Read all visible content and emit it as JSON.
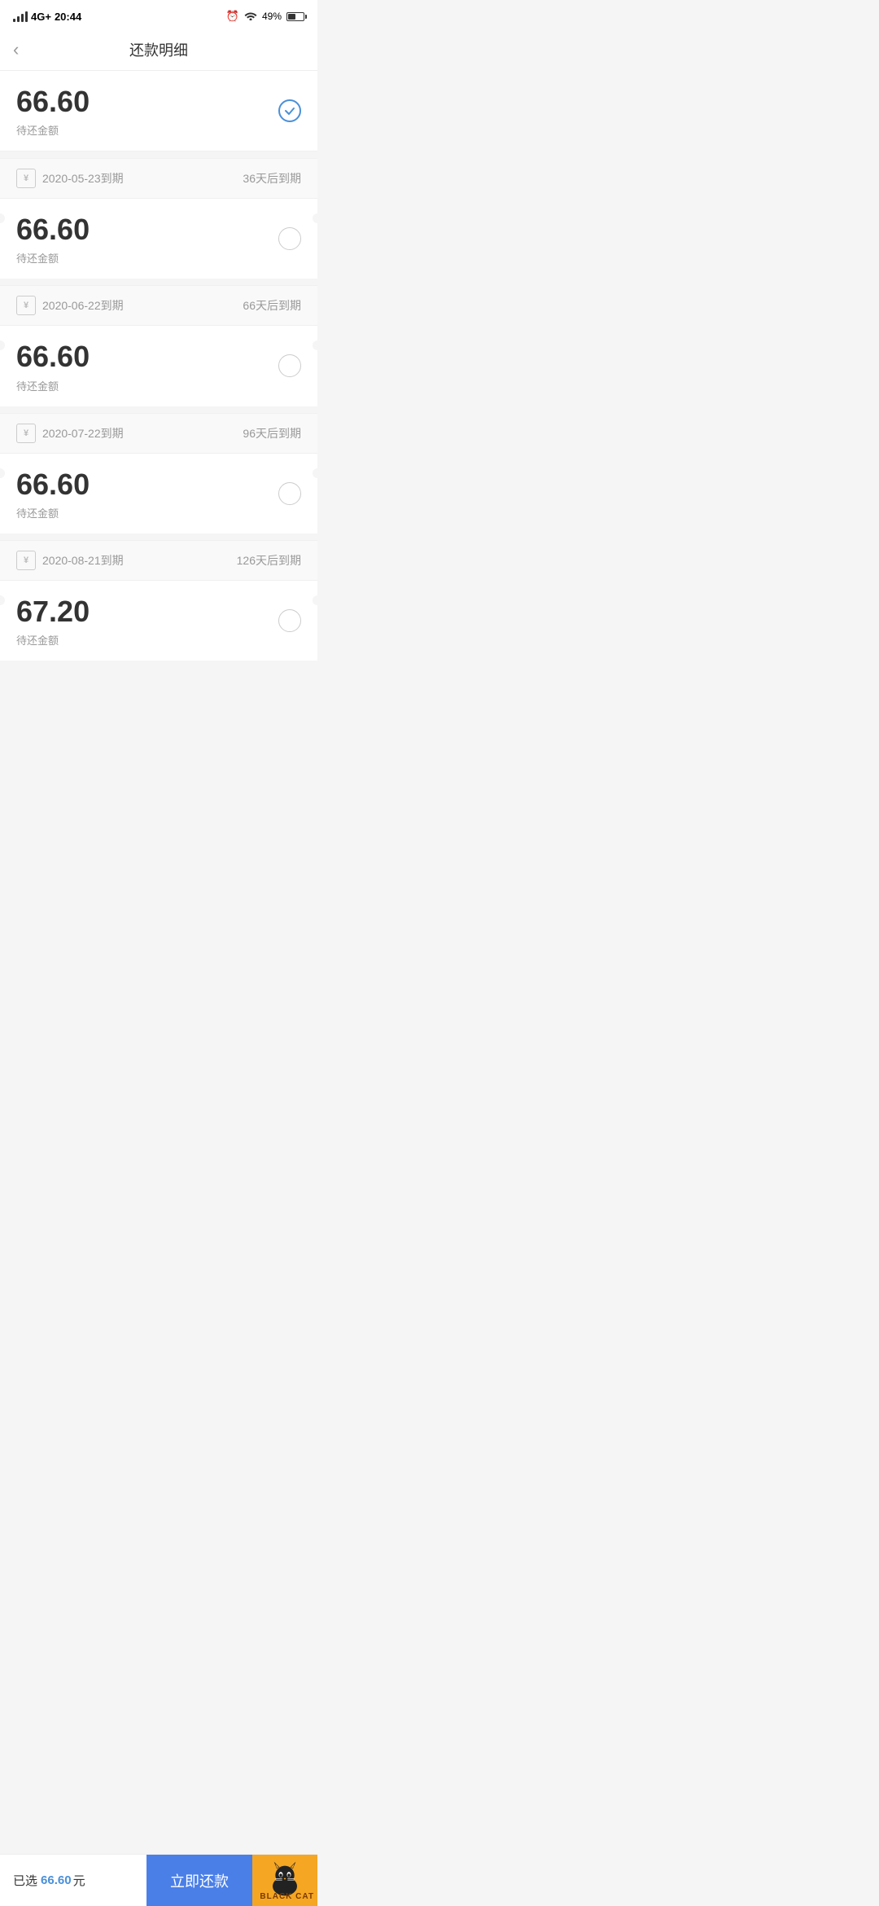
{
  "statusBar": {
    "time": "20:44",
    "network": "4G+",
    "battery": "49%"
  },
  "header": {
    "backLabel": "‹",
    "title": "还款明细"
  },
  "firstItem": {
    "amount": "66.60",
    "label": "待还金额",
    "selected": true
  },
  "payments": [
    {
      "date": "2020-05-23到期",
      "daysLabel": "36天后到期",
      "amount": "66.60",
      "amountLabel": "待还金额"
    },
    {
      "date": "2020-06-22到期",
      "daysLabel": "66天后到期",
      "amount": "66.60",
      "amountLabel": "待还金额"
    },
    {
      "date": "2020-07-22到期",
      "daysLabel": "96天后到期",
      "amount": "66.60",
      "amountLabel": "待还金额"
    },
    {
      "date": "2020-08-21到期",
      "daysLabel": "126天后到期",
      "amount": "67.20",
      "amountLabel": "待还金额"
    }
  ],
  "bottomBar": {
    "selectedLabel": "已选",
    "selectedAmount": "66.60",
    "selectedUnit": "元",
    "payBtnLabel": "立即还款",
    "blackCatLabel": "BLACK CAT"
  }
}
